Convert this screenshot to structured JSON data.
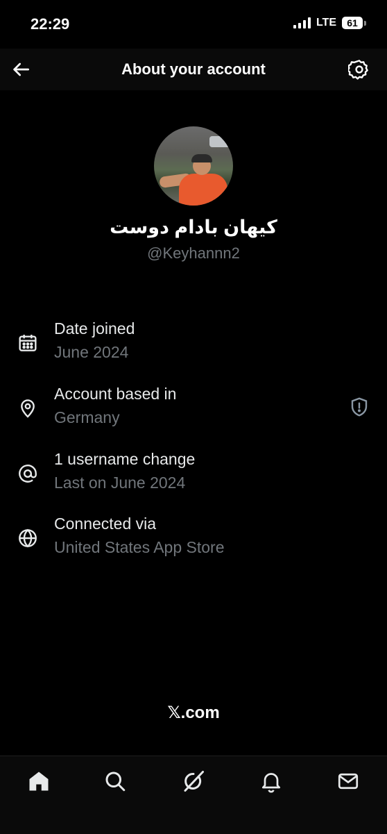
{
  "status_bar": {
    "time": "22:29",
    "network": "LTE",
    "battery": "61"
  },
  "header": {
    "title": "About your account",
    "back_icon": "arrow-left-icon",
    "settings_icon": "gear-icon"
  },
  "profile": {
    "display_name": "کیهان بادام دوست",
    "handle": "@Keyhannn2"
  },
  "info": [
    {
      "icon": "calendar-icon",
      "label": "Date joined",
      "value": "June 2024"
    },
    {
      "icon": "location-pin-icon",
      "label": "Account based in",
      "value": "Germany"
    },
    {
      "icon": "at-sign-icon",
      "label": "1 username change",
      "value": "Last on June 2024"
    },
    {
      "icon": "globe-icon",
      "label": "Connected via",
      "value": "United States App Store"
    }
  ],
  "footer": {
    "brand": "𝕏.com"
  },
  "tab_bar": [
    "home-icon",
    "search-icon",
    "grok-icon",
    "bell-icon",
    "mail-icon"
  ]
}
